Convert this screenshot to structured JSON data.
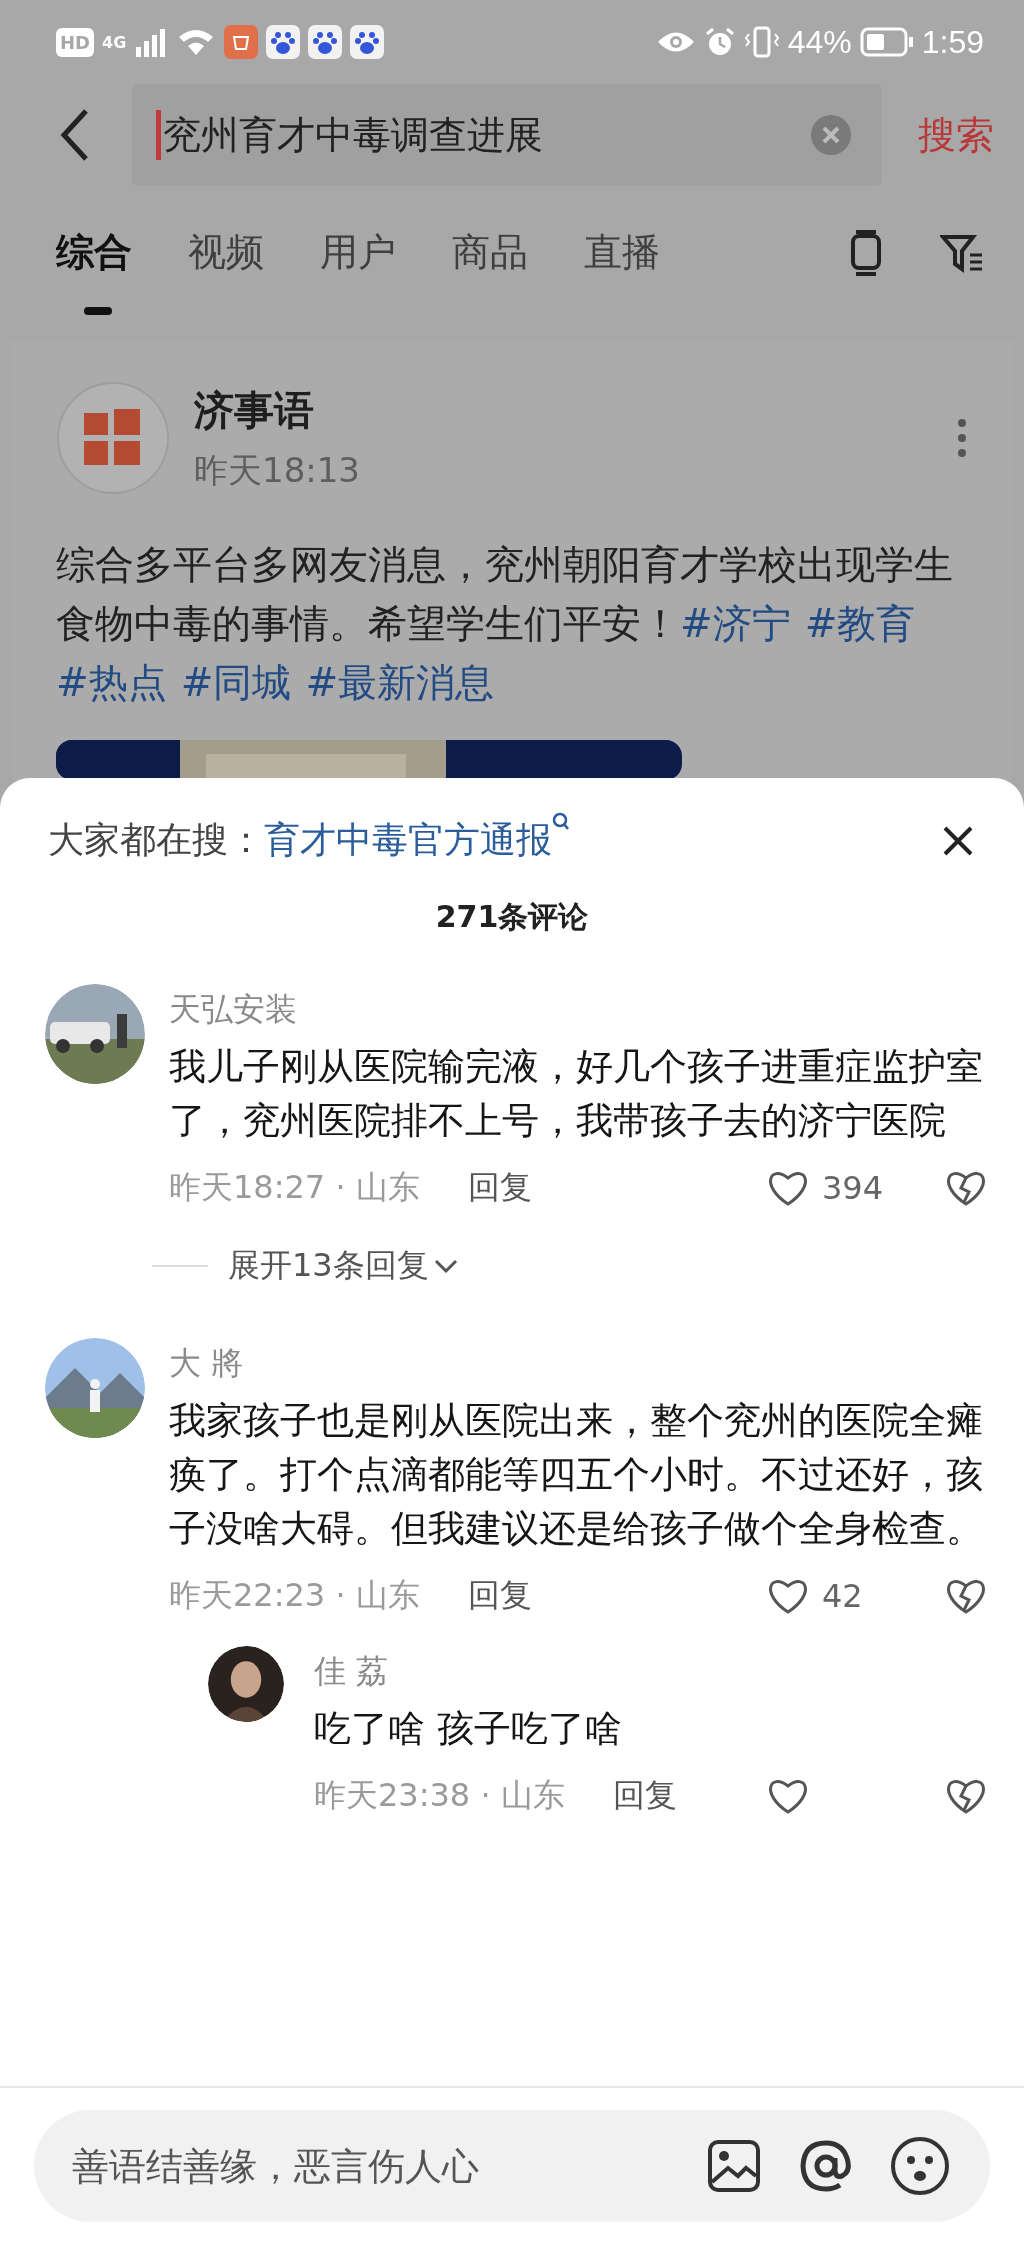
{
  "status_bar": {
    "hd": "HD",
    "network": "4G",
    "battery": "44%",
    "time": "1:59"
  },
  "search": {
    "value": "兖州育才中毒调查进展",
    "submit": "搜索"
  },
  "tabs": [
    {
      "label": "综合",
      "selected": true
    },
    {
      "label": "视频",
      "selected": false
    },
    {
      "label": "用户",
      "selected": false
    },
    {
      "label": "商品",
      "selected": false
    },
    {
      "label": "直播",
      "selected": false
    }
  ],
  "post": {
    "author": "济事语",
    "time": "昨天18:13",
    "text": "综合多平台多网友消息，兖州朝阳育才学校出现学生食物中毒的事情。希望学生们平安！",
    "hashtags": [
      "#济宁",
      "#教育",
      "#热点",
      "#同城",
      "#最新消息"
    ]
  },
  "hot_search": {
    "label": "大家都在搜：",
    "query": "育才中毒官方通报"
  },
  "comment_count": "271条评论",
  "comments": [
    {
      "name": "天弘安装",
      "text": "我儿子刚从医院输完液，好几个孩子进重症监护室了，兖州医院排不上号，我带孩子去的济宁医院",
      "time": "昨天18:27 · 山东",
      "reply": "回复",
      "likes": "394",
      "liked": false,
      "expand": "展开13条回复"
    },
    {
      "name": "大 將",
      "text": "我家孩子也是刚从医院出来，整个兖州的医院全瘫痪了。打个点滴都能等四五个小时。不过还好，孩子没啥大碍。但我建议还是给孩子做个全身检查。",
      "time": "昨天22:23 · 山东",
      "reply": "回复",
      "likes": "42",
      "liked": false,
      "replies": [
        {
          "name": "佳 荔",
          "text": "吃了啥 孩子吃了啥",
          "time": "昨天23:38 · 山东",
          "reply": "回复",
          "liked": false
        }
      ]
    }
  ],
  "input": {
    "placeholder": "善语结善缘，恶言伤人心"
  }
}
